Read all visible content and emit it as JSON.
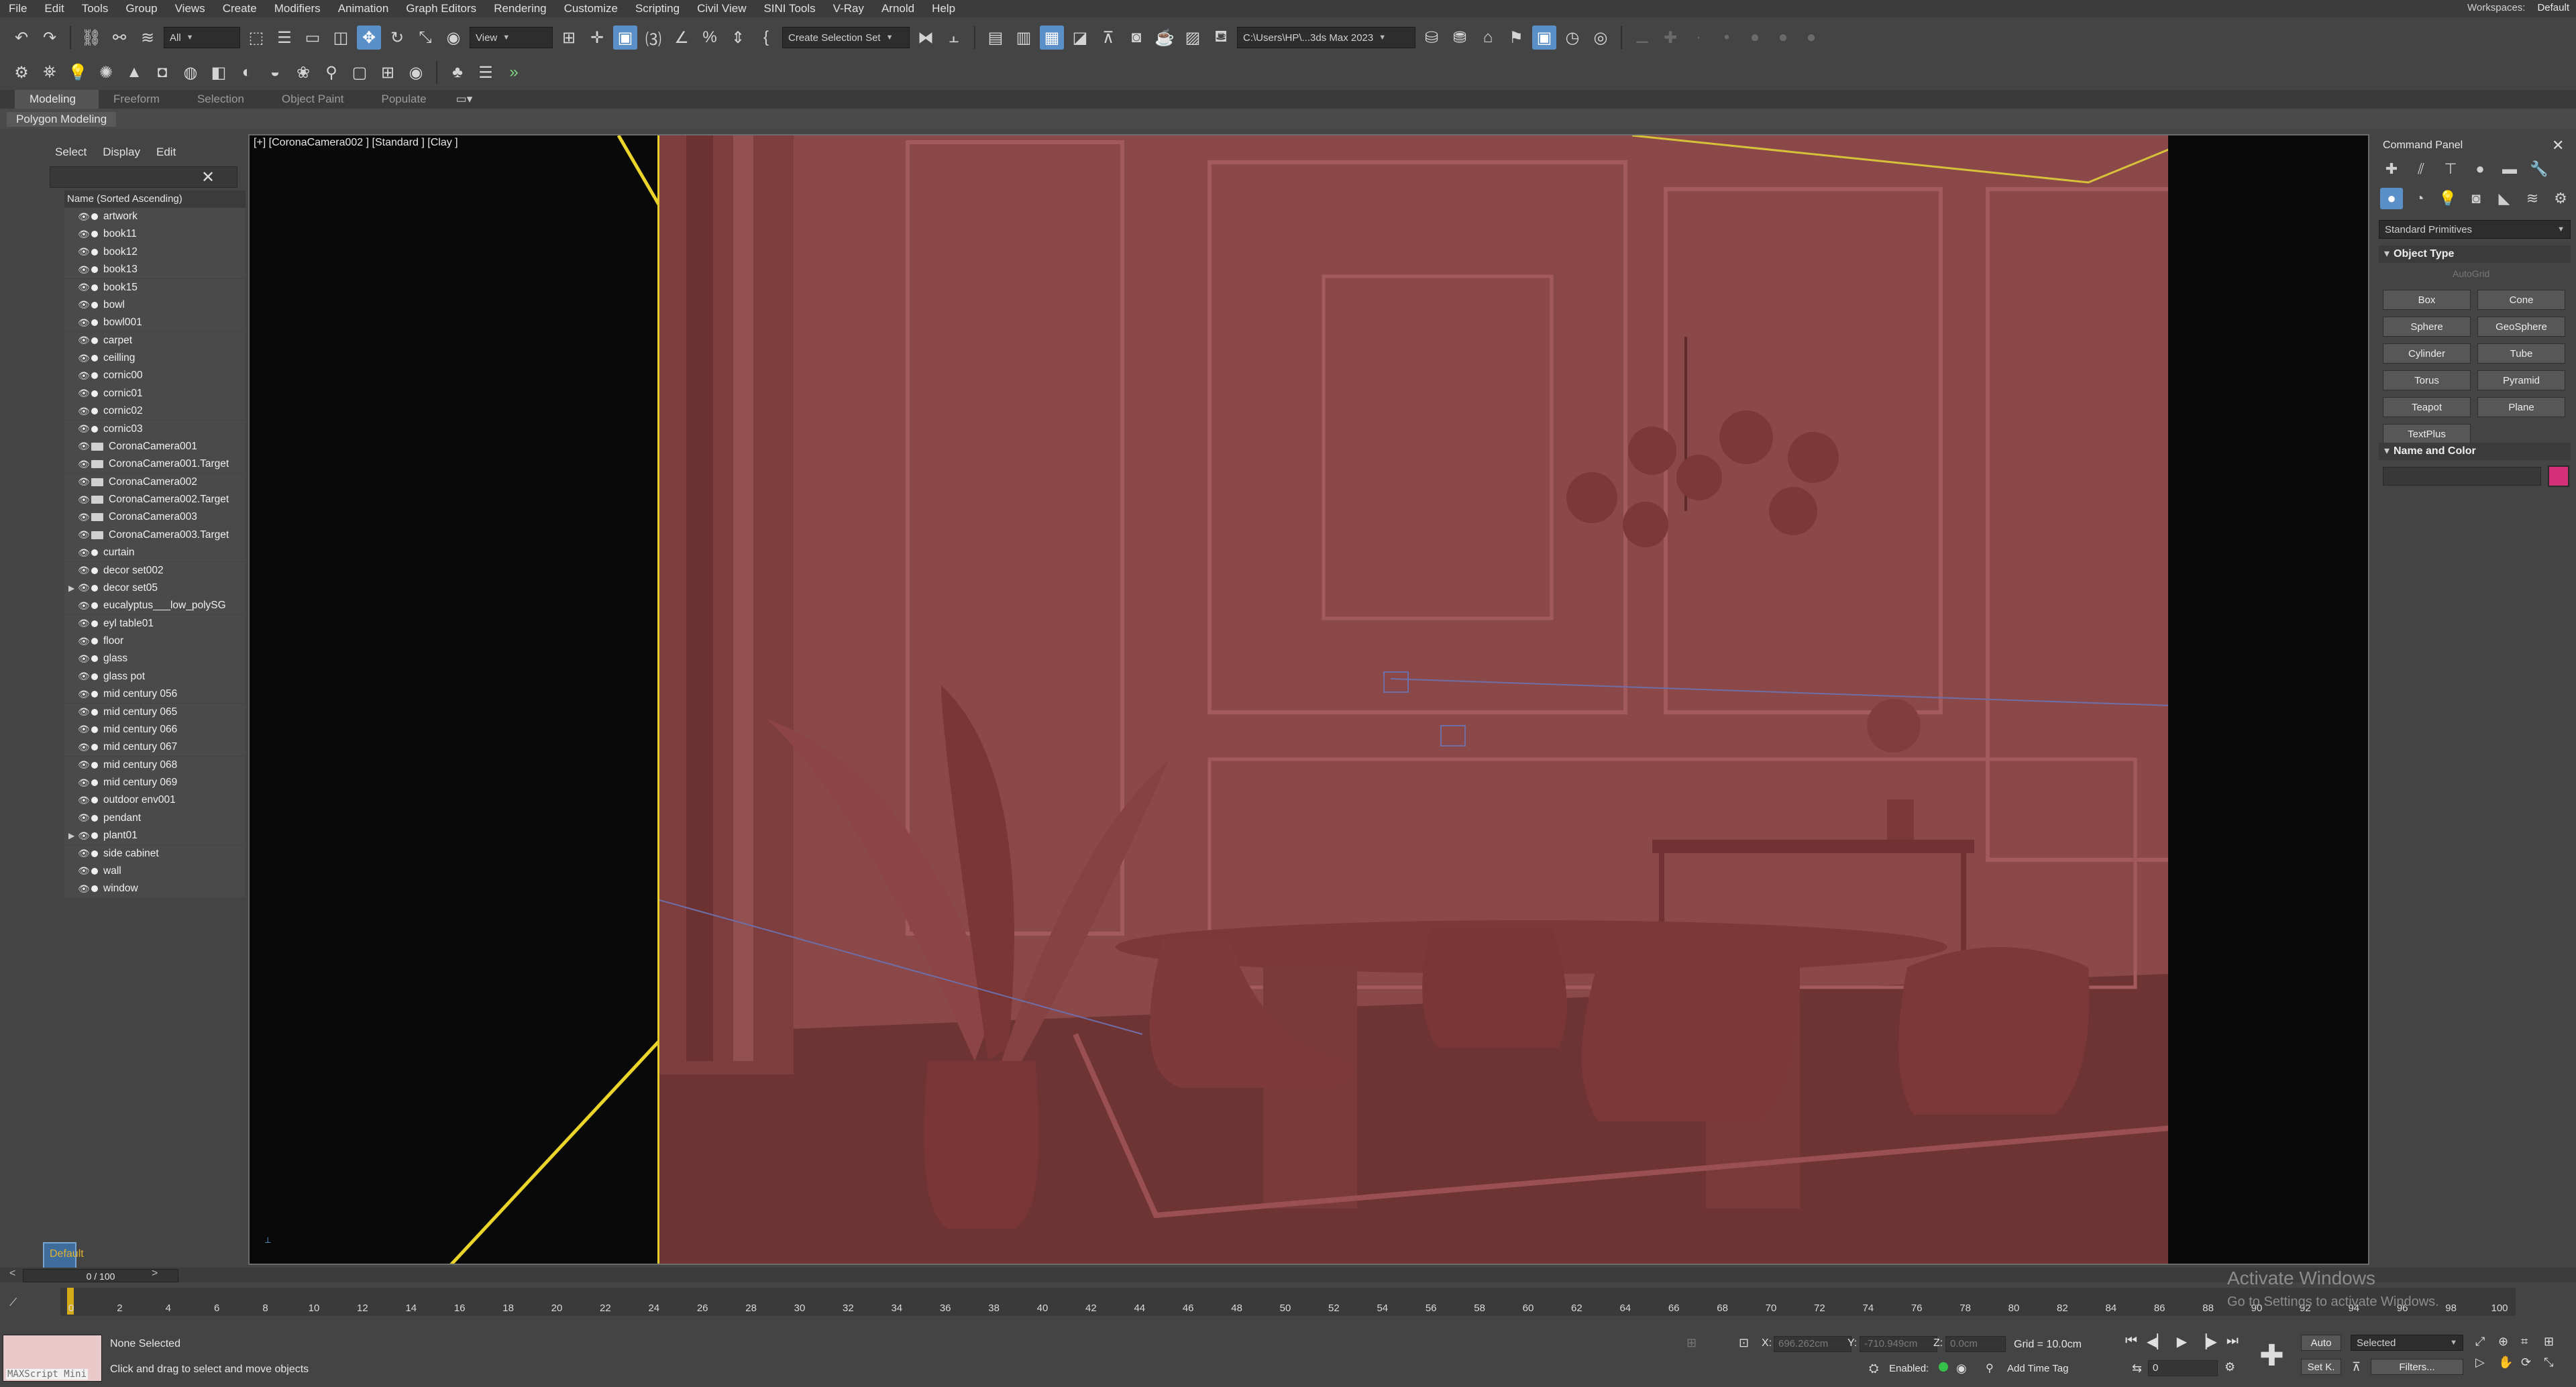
{
  "menu": [
    "File",
    "Edit",
    "Tools",
    "Group",
    "Views",
    "Create",
    "Modifiers",
    "Animation",
    "Graph Editors",
    "Rendering",
    "Customize",
    "Scripting",
    "Civil View",
    "SINI Tools",
    "V-Ray",
    "Arnold",
    "Help"
  ],
  "workspace": {
    "label": "Workspaces:",
    "value": "Default"
  },
  "toolbar": {
    "filter_value": "All",
    "view_value": "View",
    "selection_set_placeholder": "Create Selection Set",
    "project_path": "C:\\Users\\HP\\...3ds Max 2023"
  },
  "ribbon": {
    "tabs": [
      "Modeling",
      "Freeform",
      "Selection",
      "Object Paint",
      "Populate"
    ],
    "active": "Modeling",
    "sub_label": "Polygon Modeling"
  },
  "explorer": {
    "tabs": [
      "Select",
      "Display",
      "Edit"
    ],
    "column_header": "Name (Sorted Ascending)",
    "items": [
      {
        "name": "artwork",
        "type": "geo"
      },
      {
        "name": "book11",
        "type": "geo"
      },
      {
        "name": "book12",
        "type": "geo"
      },
      {
        "name": "book13",
        "type": "geo"
      },
      {
        "name": "book15",
        "type": "geo"
      },
      {
        "name": "bowl",
        "type": "geo"
      },
      {
        "name": "bowl001",
        "type": "geo"
      },
      {
        "name": "carpet",
        "type": "geo"
      },
      {
        "name": "ceilling",
        "type": "geo"
      },
      {
        "name": "cornic00",
        "type": "geo"
      },
      {
        "name": "cornic01",
        "type": "geo"
      },
      {
        "name": "cornic02",
        "type": "geo"
      },
      {
        "name": "cornic03",
        "type": "geo"
      },
      {
        "name": "CoronaCamera001",
        "type": "cam"
      },
      {
        "name": "CoronaCamera001.Target",
        "type": "cam"
      },
      {
        "name": "CoronaCamera002",
        "type": "cam"
      },
      {
        "name": "CoronaCamera002.Target",
        "type": "cam"
      },
      {
        "name": "CoronaCamera003",
        "type": "cam"
      },
      {
        "name": "CoronaCamera003.Target",
        "type": "cam"
      },
      {
        "name": "curtain",
        "type": "geo"
      },
      {
        "name": "decor set002",
        "type": "geo"
      },
      {
        "name": "decor set05",
        "type": "group"
      },
      {
        "name": "eucalyptus___low_polySG",
        "type": "geo"
      },
      {
        "name": "eyl table01",
        "type": "geo"
      },
      {
        "name": "floor",
        "type": "geo"
      },
      {
        "name": "glass",
        "type": "geo"
      },
      {
        "name": "glass pot",
        "type": "geo"
      },
      {
        "name": "mid century 056",
        "type": "geo"
      },
      {
        "name": "mid century 065",
        "type": "geo"
      },
      {
        "name": "mid century 066",
        "type": "geo"
      },
      {
        "name": "mid century 067",
        "type": "geo"
      },
      {
        "name": "mid century 068",
        "type": "geo"
      },
      {
        "name": "mid century 069",
        "type": "geo"
      },
      {
        "name": "outdoor env001",
        "type": "geo"
      },
      {
        "name": "pendant",
        "type": "geo"
      },
      {
        "name": "plant01",
        "type": "group"
      },
      {
        "name": "side cabinet",
        "type": "geo"
      },
      {
        "name": "wall",
        "type": "geo"
      },
      {
        "name": "window",
        "type": "geo"
      }
    ],
    "layer": "Default"
  },
  "viewport": {
    "label": "[+] [CoronaCamera002 ] [Standard ] [Clay ]"
  },
  "command_panel": {
    "title": "Command Panel",
    "dropdown": "Standard Primitives",
    "object_type_header": "Object Type",
    "autogrid": "AutoGrid",
    "primitives": [
      "Box",
      "Cone",
      "Sphere",
      "GeoSphere",
      "Cylinder",
      "Tube",
      "Torus",
      "Pyramid",
      "Teapot",
      "Plane",
      "TextPlus"
    ],
    "name_color_header": "Name and Color",
    "swatch_color": "#d4317a"
  },
  "timeline": {
    "frame_display": "0 / 100",
    "ticks": [
      0,
      2,
      4,
      6,
      8,
      10,
      12,
      14,
      16,
      18,
      20,
      22,
      24,
      26,
      28,
      30,
      32,
      34,
      36,
      38,
      40,
      42,
      44,
      46,
      48,
      50,
      52,
      54,
      56,
      58,
      60,
      62,
      64,
      66,
      68,
      70,
      72,
      74,
      76,
      78,
      80,
      82,
      84,
      86,
      88,
      90,
      92,
      94,
      96,
      98,
      100
    ]
  },
  "watermark": {
    "line1": "Activate Windows",
    "line2": "Go to Settings to activate Windows."
  },
  "status": {
    "maxscript": "MAXScript Mini",
    "selection": "None Selected",
    "hint": "Click and drag to select and move objects",
    "x_label": "X:",
    "x_value": "696.262cm",
    "y_label": "Y:",
    "y_value": "-710.949cm",
    "z_label": "Z:",
    "z_value": "0.0cm",
    "grid": "Grid = 10.0cm",
    "enabled": "Enabled:",
    "add_time_tag": "Add Time Tag",
    "auto": "Auto",
    "set_key": "Set K.",
    "selected": "Selected",
    "filters": "Filters...",
    "frame": "0"
  }
}
